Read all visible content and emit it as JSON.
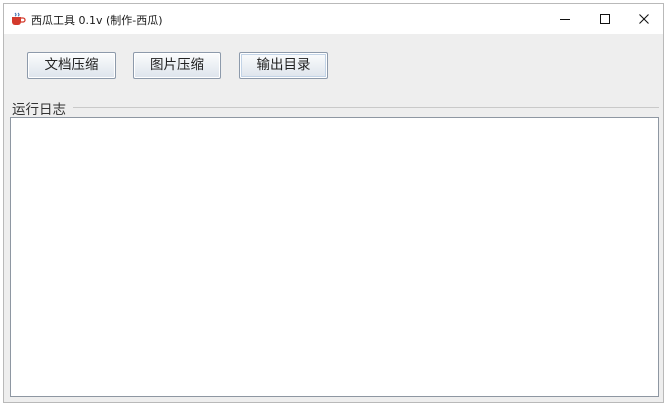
{
  "window": {
    "title": "西瓜工具 0.1v (制作-西瓜)",
    "app_icon": "java-cup-icon",
    "controls": {
      "minimize_icon": "minimize-icon",
      "maximize_icon": "maximize-icon",
      "close_icon": "close-icon"
    }
  },
  "toolbar": {
    "doc_compress_label": "文档压缩",
    "image_compress_label": "图片压缩",
    "output_dir_label": "输出目录"
  },
  "log": {
    "group_title": "运行日志",
    "content": ""
  },
  "colors": {
    "window_bg": "#eeeeee",
    "titlebar_bg": "#ffffff",
    "button_border": "#8d9aab",
    "log_border": "#8e97a2"
  }
}
